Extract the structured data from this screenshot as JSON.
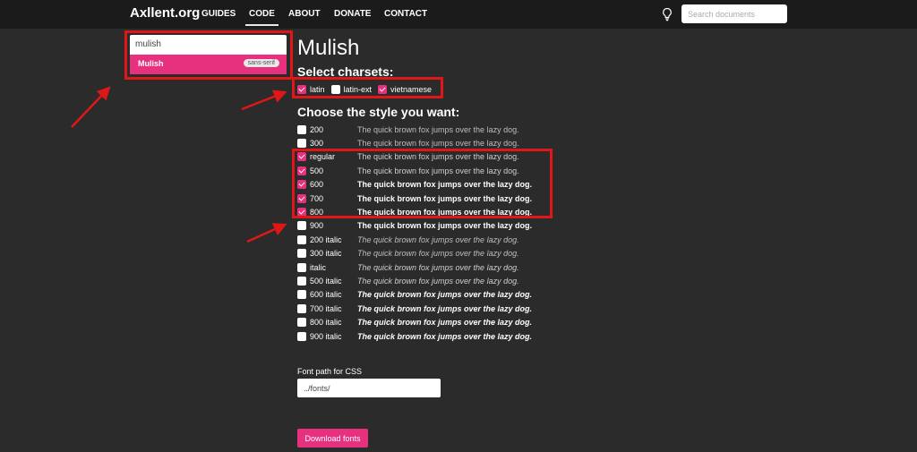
{
  "nav": {
    "brand": "Axllent.org",
    "links": [
      {
        "label": "GUIDES",
        "active": false
      },
      {
        "label": "CODE",
        "active": true
      },
      {
        "label": "ABOUT",
        "active": false
      },
      {
        "label": "DONATE",
        "active": false
      },
      {
        "label": "CONTACT",
        "active": false
      }
    ],
    "search_placeholder": "Search documents"
  },
  "dropdown": {
    "input_value": "mulish",
    "option_name": "Mulish",
    "option_badge": "sans-serif"
  },
  "main": {
    "title": "Mulish",
    "charsets_heading": "Select charsets:",
    "charsets": [
      {
        "label": "latin",
        "checked": true
      },
      {
        "label": "latin-ext",
        "checked": false
      },
      {
        "label": "vietnamese",
        "checked": true
      }
    ],
    "styles_heading": "Choose the style you want:",
    "sample_text": "The quick brown fox jumps over the lazy dog.",
    "styles": [
      {
        "label": "200",
        "checked": false,
        "weight": 200,
        "italic": false
      },
      {
        "label": "300",
        "checked": false,
        "weight": 300,
        "italic": false
      },
      {
        "label": "regular",
        "checked": true,
        "weight": 400,
        "italic": false
      },
      {
        "label": "500",
        "checked": true,
        "weight": 500,
        "italic": false
      },
      {
        "label": "600",
        "checked": true,
        "weight": 600,
        "italic": false
      },
      {
        "label": "700",
        "checked": true,
        "weight": 700,
        "italic": false
      },
      {
        "label": "800",
        "checked": true,
        "weight": 800,
        "italic": false
      },
      {
        "label": "900",
        "checked": false,
        "weight": 900,
        "italic": false
      },
      {
        "label": "200 italic",
        "checked": false,
        "weight": 200,
        "italic": true
      },
      {
        "label": "300 italic",
        "checked": false,
        "weight": 300,
        "italic": true
      },
      {
        "label": "italic",
        "checked": false,
        "weight": 400,
        "italic": true
      },
      {
        "label": "500 italic",
        "checked": false,
        "weight": 500,
        "italic": true
      },
      {
        "label": "600 italic",
        "checked": false,
        "weight": 600,
        "italic": true
      },
      {
        "label": "700 italic",
        "checked": false,
        "weight": 700,
        "italic": true
      },
      {
        "label": "800 italic",
        "checked": false,
        "weight": 800,
        "italic": true
      },
      {
        "label": "900 italic",
        "checked": false,
        "weight": 900,
        "italic": true
      }
    ],
    "font_path_label": "Font path for CSS",
    "font_path_value": "../fonts/",
    "download_label": "Download fonts"
  },
  "colors": {
    "accent": "#e8317e",
    "annotation": "#e01717",
    "background": "#2b2b2b",
    "nav_background": "#1b1b1b"
  },
  "icons": {
    "theme_toggle": "lightbulb-icon"
  }
}
